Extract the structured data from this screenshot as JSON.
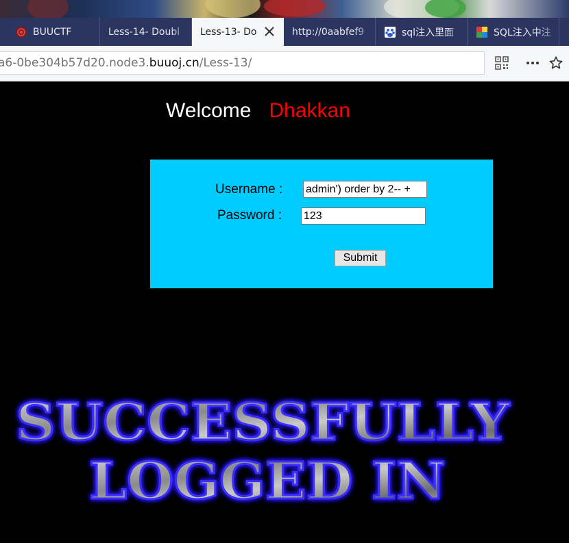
{
  "browser": {
    "tabs": [
      {
        "label": "BUUCTF",
        "icon": "buuctf-favicon",
        "active": false
      },
      {
        "label": "Less-14- Doubl",
        "icon": "",
        "active": false
      },
      {
        "label": "Less-13- Do",
        "icon": "",
        "active": true
      },
      {
        "label": "http://0aabfef9",
        "icon": "",
        "active": false
      },
      {
        "label": "sql注入里面",
        "icon": "baidu-favicon",
        "active": false
      },
      {
        "label": "SQL注入中注",
        "icon": "colorful-favicon",
        "active": false
      }
    ],
    "url": {
      "prefix": "a6-0be304b57d20.node3.",
      "host": "buuoj.cn",
      "path": "/Less-13/"
    },
    "icons": [
      "qr-code-icon",
      "more-icon",
      "bookmark-star-icon",
      "close-icon"
    ]
  },
  "page": {
    "welcome": "Welcome",
    "name": "Dhakkan",
    "form": {
      "username_label": "Username :",
      "username_value": "admin') order by 2-- +",
      "password_label": "Password :",
      "password_value": "123",
      "submit_label": "Submit"
    },
    "banner": {
      "line1": "SUCCESSFULLY",
      "line2": "LOGGED IN"
    }
  },
  "colors": {
    "form_bg": "#00ccff",
    "name_color": "#ff0000",
    "tabbar_bg": "#2b3560",
    "page_bg": "#000000"
  }
}
